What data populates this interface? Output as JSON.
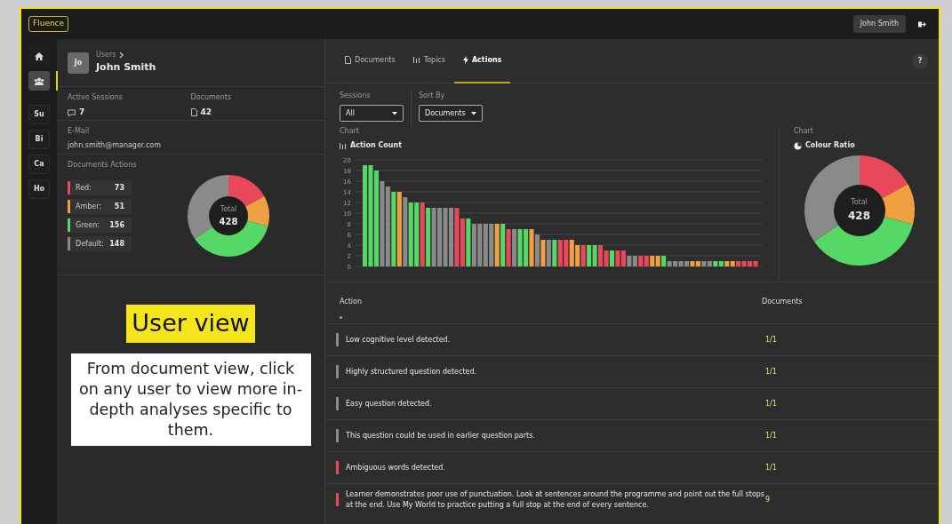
{
  "app": {
    "logo": "Fluence",
    "user_button": "John Smith"
  },
  "nav": [
    {
      "kind": "home",
      "selected": false
    },
    {
      "kind": "users",
      "selected": true
    },
    {
      "kind": "text",
      "label": "Su",
      "selected": false
    },
    {
      "kind": "text",
      "label": "Bi",
      "selected": false
    },
    {
      "kind": "text",
      "label": "Ca",
      "selected": false
    },
    {
      "kind": "text",
      "label": "Ho",
      "selected": false
    }
  ],
  "user": {
    "avatar": "Jo",
    "breadcrumb": "Users",
    "name": "John Smith",
    "stats": [
      {
        "label": "Active Sessions",
        "value": "7"
      },
      {
        "label": "Documents",
        "value": "42"
      }
    ],
    "email": {
      "label": "E-Mail",
      "value": "john.smith@manager.com"
    }
  },
  "doc_actions": {
    "title": "Documents Actions",
    "items": [
      {
        "label": "Red:",
        "value": "73",
        "color": "#e8485a"
      },
      {
        "label": "Amber:",
        "value": "51",
        "color": "#f0a040"
      },
      {
        "label": "Green:",
        "value": "156",
        "color": "#55d865"
      },
      {
        "label": "Default:",
        "value": "148",
        "color": "#8a8a8a"
      }
    ],
    "total_label": "Total",
    "total": "428",
    "chart_data": {
      "type": "donut",
      "values": [
        17.06,
        11.92,
        36.45,
        34.57
      ]
    }
  },
  "caption": {
    "highlight": "User view",
    "text": "From document view, click on any user to view more in-depth analyses specific to them."
  },
  "tabs": [
    {
      "label": "Documents",
      "selected": false
    },
    {
      "label": "Topics",
      "selected": false
    },
    {
      "label": "Actions",
      "selected": true
    }
  ],
  "help": "?",
  "filters": [
    {
      "label": "Sessions",
      "value": "All"
    },
    {
      "label": "Sort By",
      "value": "Documents"
    }
  ],
  "action_chart": {
    "caption": "Chart",
    "title": "Action Count",
    "chart_data": {
      "type": "bar",
      "stacked": true,
      "grid": true,
      "ylim": [
        0,
        20
      ],
      "yticks": [
        0,
        2,
        4,
        6,
        8,
        10,
        12,
        14,
        16,
        18,
        20
      ],
      "series": [
        {
          "color": "#55d865",
          "values": [
            19,
            19,
            18,
            null,
            null,
            14,
            null,
            null,
            12,
            12,
            null,
            11,
            null,
            null,
            null,
            null,
            null,
            null,
            9,
            null,
            null,
            null,
            null,
            null,
            8,
            null,
            null,
            7,
            7,
            null,
            null,
            null,
            null,
            5,
            null,
            null,
            null,
            null,
            null,
            4,
            4,
            null,
            null,
            3,
            null,
            null,
            null,
            null,
            null,
            null,
            null,
            null,
            2,
            null,
            null,
            null,
            null,
            null,
            null,
            null,
            null,
            1,
            1,
            null,
            null,
            null,
            null,
            null,
            null
          ]
        },
        {
          "color": "#f0a040",
          "values": [
            null,
            null,
            null,
            null,
            null,
            null,
            14,
            null,
            null,
            null,
            null,
            null,
            null,
            null,
            null,
            null,
            null,
            null,
            null,
            null,
            null,
            null,
            null,
            8,
            null,
            null,
            null,
            null,
            null,
            7,
            null,
            5,
            null,
            null,
            null,
            null,
            5,
            4,
            null,
            null,
            null,
            null,
            null,
            null,
            null,
            null,
            null,
            null,
            null,
            null,
            2,
            2,
            null,
            null,
            null,
            null,
            null,
            1,
            1,
            null,
            null,
            null,
            null,
            1,
            1,
            null,
            null,
            null,
            null
          ]
        },
        {
          "color": "#e8485a",
          "values": [
            null,
            null,
            null,
            null,
            null,
            null,
            null,
            null,
            null,
            null,
            12,
            null,
            null,
            null,
            null,
            null,
            11,
            9,
            null,
            null,
            null,
            null,
            null,
            null,
            null,
            7,
            null,
            null,
            null,
            null,
            null,
            null,
            null,
            null,
            5,
            5,
            null,
            null,
            4,
            null,
            null,
            4,
            3,
            null,
            3,
            3,
            null,
            null,
            2,
            2,
            null,
            null,
            null,
            null,
            null,
            null,
            null,
            null,
            null,
            null,
            null,
            null,
            null,
            null,
            null,
            1,
            1,
            1,
            1
          ]
        },
        {
          "color": "#8a8a8a",
          "values": [
            null,
            null,
            null,
            16,
            15,
            null,
            null,
            13,
            null,
            null,
            null,
            null,
            11,
            11,
            11,
            11,
            null,
            null,
            null,
            8,
            8,
            8,
            8,
            null,
            null,
            null,
            7,
            null,
            null,
            null,
            6,
            null,
            5,
            null,
            null,
            null,
            null,
            null,
            null,
            null,
            null,
            null,
            null,
            null,
            null,
            null,
            2,
            2,
            null,
            null,
            null,
            null,
            null,
            1,
            1,
            1,
            1,
            null,
            null,
            1,
            1,
            null,
            null,
            null,
            null,
            null,
            null,
            null,
            null
          ]
        }
      ]
    }
  },
  "ratio_chart": {
    "caption": "Chart",
    "title": "Colour Ratio",
    "total_label": "Total",
    "total": "428",
    "chart_data": {
      "type": "donut",
      "values": [
        17.06,
        11.92,
        36.45,
        34.57
      ]
    }
  },
  "table": {
    "columns": [
      "Action",
      "Documents"
    ],
    "rows": [
      {
        "action": "Low cognitive level detected.",
        "documents": "1/1",
        "color": "#8a8a8a"
      },
      {
        "action": "Highly structured question detected.",
        "documents": "1/1",
        "color": "#8a8a8a"
      },
      {
        "action": "Easy question detected.",
        "documents": "1/1",
        "color": "#8a8a8a"
      },
      {
        "action": "This question could be used in earlier question parts.",
        "documents": "1/1",
        "color": "#8a8a8a"
      },
      {
        "action": "Ambiguous words detected.",
        "documents": "1/1",
        "color": "#e8485a"
      },
      {
        "action": "Learner demonstrates poor use of punctuation. Look at sentences around the programme and point out the full stops at the end. Use My World to practice putting a full stop at the end of every sentence.",
        "documents": "9",
        "color": "#e8485a"
      }
    ]
  }
}
